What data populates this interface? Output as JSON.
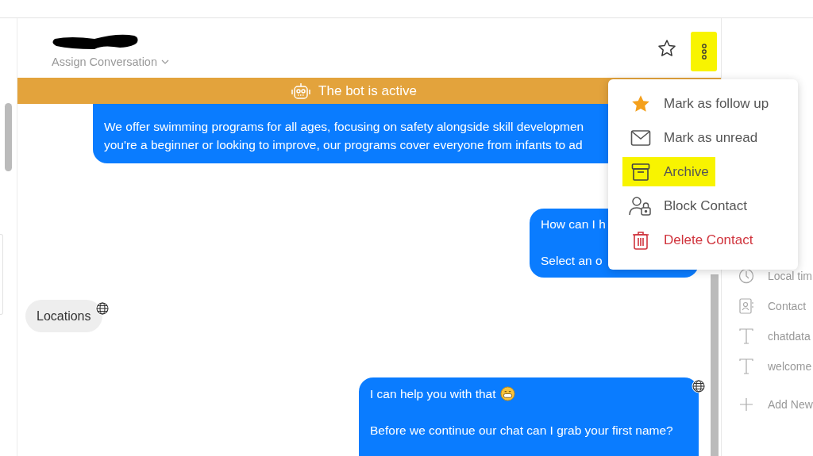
{
  "header": {
    "assign_label": "Assign Conversation",
    "starred": false,
    "more_button": {
      "highlighted": true
    }
  },
  "banner": {
    "text": "The bot is active"
  },
  "messages": [
    {
      "kind": "outgoing",
      "lines": [
        "We offer swimming programs for all ages, focusing on safety alongside skill developmen",
        "you're a beginner or looking to improve, our programs cover everyone from infants to ad"
      ],
      "paragraph_gap": false,
      "emoji": false
    },
    {
      "kind": "outgoing",
      "lines": [
        "How can I h",
        "Select an o"
      ],
      "paragraph_gap": true,
      "emoji": false
    },
    {
      "kind": "incoming",
      "lines": [
        "Locations"
      ],
      "translated": true,
      "emoji": false
    },
    {
      "kind": "outgoing",
      "lines": [
        "I can help you with that",
        "Before we continue our chat can I grab your first name?"
      ],
      "paragraph_gap": true,
      "translated": true,
      "emoji": true
    }
  ],
  "menu": [
    {
      "kind": "follow",
      "label": "Mark as follow up",
      "highlighted": false,
      "danger": false
    },
    {
      "kind": "unread",
      "label": "Mark as unread",
      "highlighted": false,
      "danger": false
    },
    {
      "kind": "archive",
      "label": "Archive",
      "highlighted": true,
      "danger": false
    },
    {
      "kind": "block",
      "label": "Block Contact",
      "highlighted": false,
      "danger": false
    },
    {
      "kind": "delete",
      "label": "Delete Contact",
      "highlighted": false,
      "danger": true
    }
  ],
  "side_panel": [
    {
      "kind": "clock",
      "label": "Local tim"
    },
    {
      "kind": "contact",
      "label": "Contact"
    },
    {
      "kind": "text",
      "label": "chatdata"
    },
    {
      "kind": "text",
      "label": "welcome"
    },
    {
      "kind": "add",
      "label": "Add New"
    }
  ]
}
